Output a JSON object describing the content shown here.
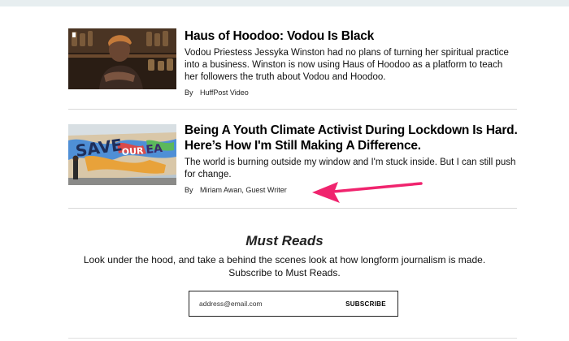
{
  "stories": [
    {
      "headline": "Haus of Hoodoo: Vodou Is Black",
      "summary": "Vodou Priestess Jessyka Winston had no plans of turning her spiritual practice into a business. Winston is now using Haus of Hoodoo as a platform to teach her followers the truth about Vodou and Hoodoo.",
      "by": "By",
      "author": "HuffPost Video"
    },
    {
      "headline": "Being A Youth Climate Activist During Lockdown Is Hard. Here’s How I'm Still Making A Difference.",
      "summary": "The world is burning outside my window and I'm stuck inside. But I can still push for change.",
      "by": "By",
      "author": "Miriam Awan, Guest Writer"
    }
  ],
  "must_reads": {
    "title": "Must Reads",
    "description_line1": "Look under the hood, and take a behind the scenes look at how longform journalism is made.",
    "description_line2": "Subscribe to Must Reads.",
    "email_placeholder": "address@email.com",
    "subscribe_label": "SUBSCRIBE"
  },
  "colors": {
    "annotation_arrow": "#f0246e",
    "top_band": "#e7eef0",
    "divider": "#d9d9d9"
  }
}
